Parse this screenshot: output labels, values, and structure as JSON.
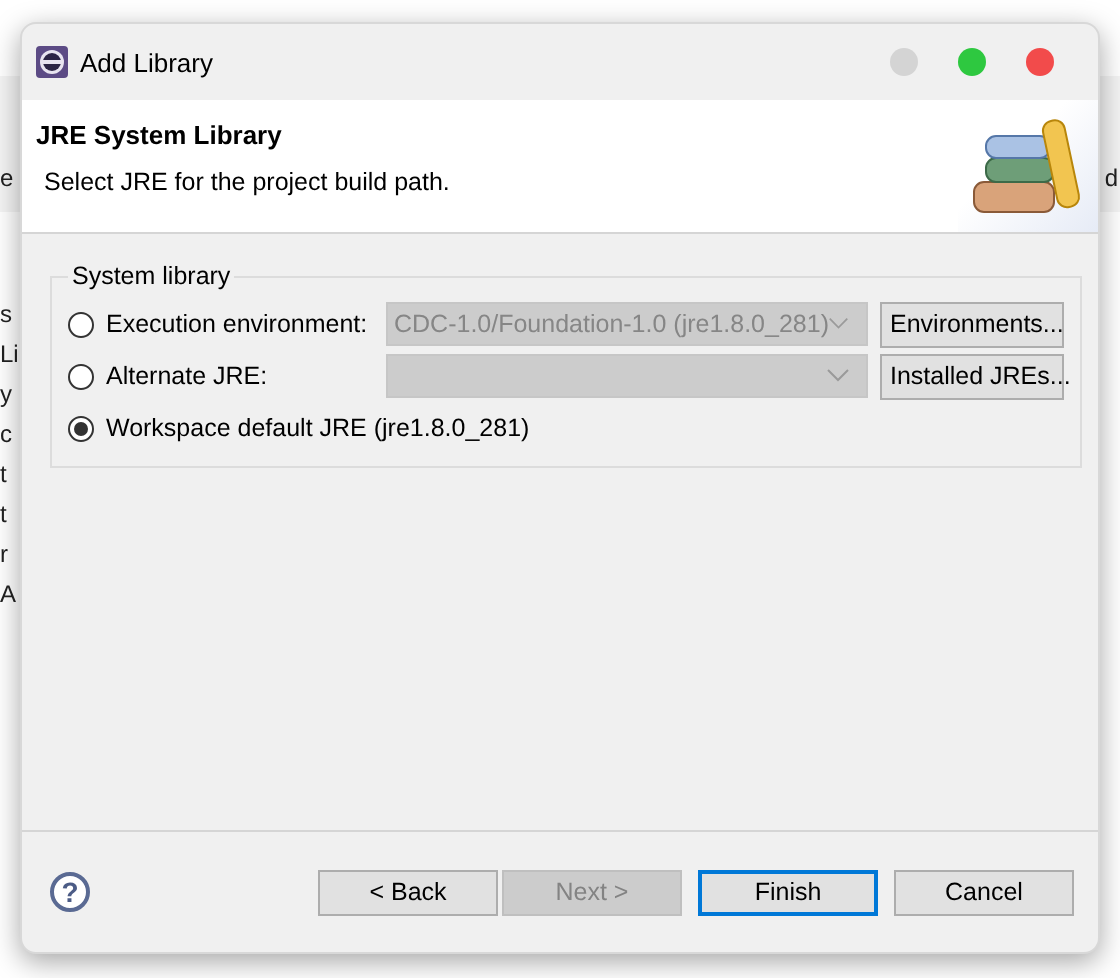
{
  "background_window": {
    "left_texts": [
      "e",
      "s",
      "Li",
      "y",
      "c",
      "t",
      "t",
      "r",
      "A"
    ],
    "right_texts": [
      "d"
    ]
  },
  "window": {
    "title": "Add Library",
    "controls": [
      {
        "color": "#d4d4d4"
      },
      {
        "color": "#2ec840"
      },
      {
        "color": "#f24b4b"
      }
    ]
  },
  "header": {
    "title": "JRE System Library",
    "description": "Select JRE for the project build path."
  },
  "group": {
    "label": "System library",
    "options": [
      {
        "label": "Execution environment:",
        "selected": false,
        "combo": {
          "value": "CDC-1.0/Foundation-1.0 (jre1.8.0_281)",
          "disabled": true
        },
        "button": "Environments..."
      },
      {
        "label": "Alternate JRE:",
        "selected": false,
        "combo": {
          "disabled": true
        },
        "button": "Installed JREs..."
      },
      {
        "label": "Workspace default JRE (jre1.8.0_281)",
        "selected": true
      }
    ]
  },
  "help": {
    "symbol": "?"
  },
  "buttons": [
    {
      "label": "< Back",
      "disabled": false,
      "default": false
    },
    {
      "label": "Next >",
      "disabled": true,
      "default": false
    },
    {
      "label": "Finish",
      "disabled": false,
      "default": true
    },
    {
      "label": "Cancel",
      "disabled": false,
      "default": false
    }
  ]
}
